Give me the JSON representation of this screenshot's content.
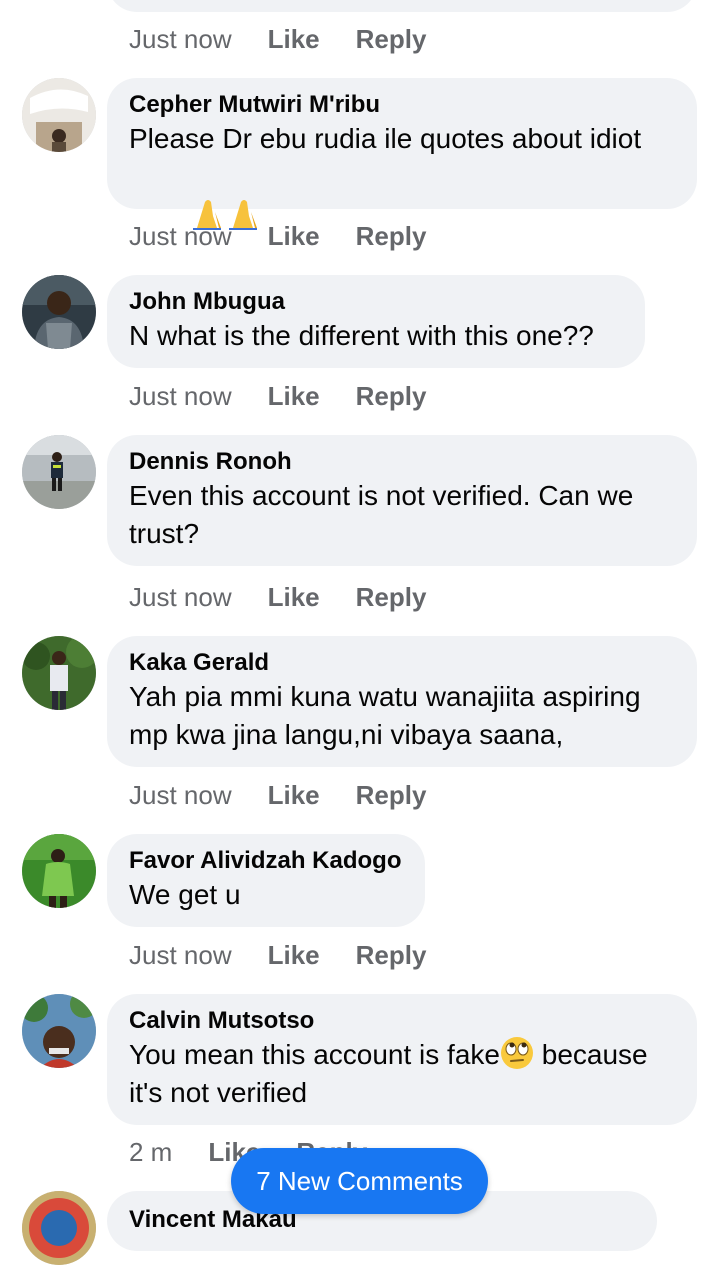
{
  "actions": {
    "like": "Like",
    "reply": "Reply"
  },
  "comments": [
    {
      "author": "Cepher Mutwiri M'ribu",
      "text": "Please Dr ebu rudia ile quotes about idiot",
      "emoji_line": "folded-hands-emoji x2",
      "time": "Just now"
    },
    {
      "author": "John Mbugua",
      "text": "N what is the different with this one??",
      "time": "Just now"
    },
    {
      "author": "Dennis Ronoh",
      "text": "Even this account is not verified. Can we trust?",
      "time": "Just now"
    },
    {
      "author": "Kaka Gerald",
      "text": "Yah pia mmi kuna watu wanajiita aspiring mp kwa jina langu,ni vibaya saana,",
      "time": "Just now"
    },
    {
      "author": "Favor Alividzah Kadogo",
      "text": "We get u",
      "time": "Just now"
    },
    {
      "author": "Calvin Mutsotso",
      "text_before_emoji": "You mean this account is fake",
      "text_after_emoji": " because it's not verified",
      "emoji": "eye-roll-emoji",
      "time": "2 m"
    }
  ],
  "top_partial": {
    "time": "Just now"
  },
  "partial_last": {
    "author": "Vincent Makau"
  },
  "new_comments_button": "7 New Comments",
  "colors": {
    "bubble": "#f0f2f5",
    "meta": "#65676b",
    "accent": "#1877f2"
  }
}
